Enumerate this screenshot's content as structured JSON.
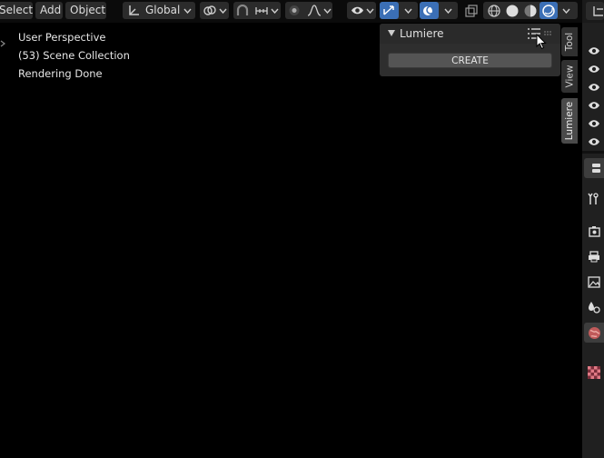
{
  "header": {
    "menu": [
      "Select",
      "Add",
      "Object"
    ],
    "orientation": "Global"
  },
  "viewport": {
    "perspective": "User Perspective",
    "collection": "(53) Scene Collection",
    "status": "Rendering Done"
  },
  "npanel": {
    "panel_title": "Lumiere",
    "create_label": "CREATE",
    "tabs": [
      "Tool",
      "View",
      "Lumiere"
    ]
  },
  "colors": {
    "active_blue": "#3b6fb6",
    "world_icon": "#e0807a"
  }
}
